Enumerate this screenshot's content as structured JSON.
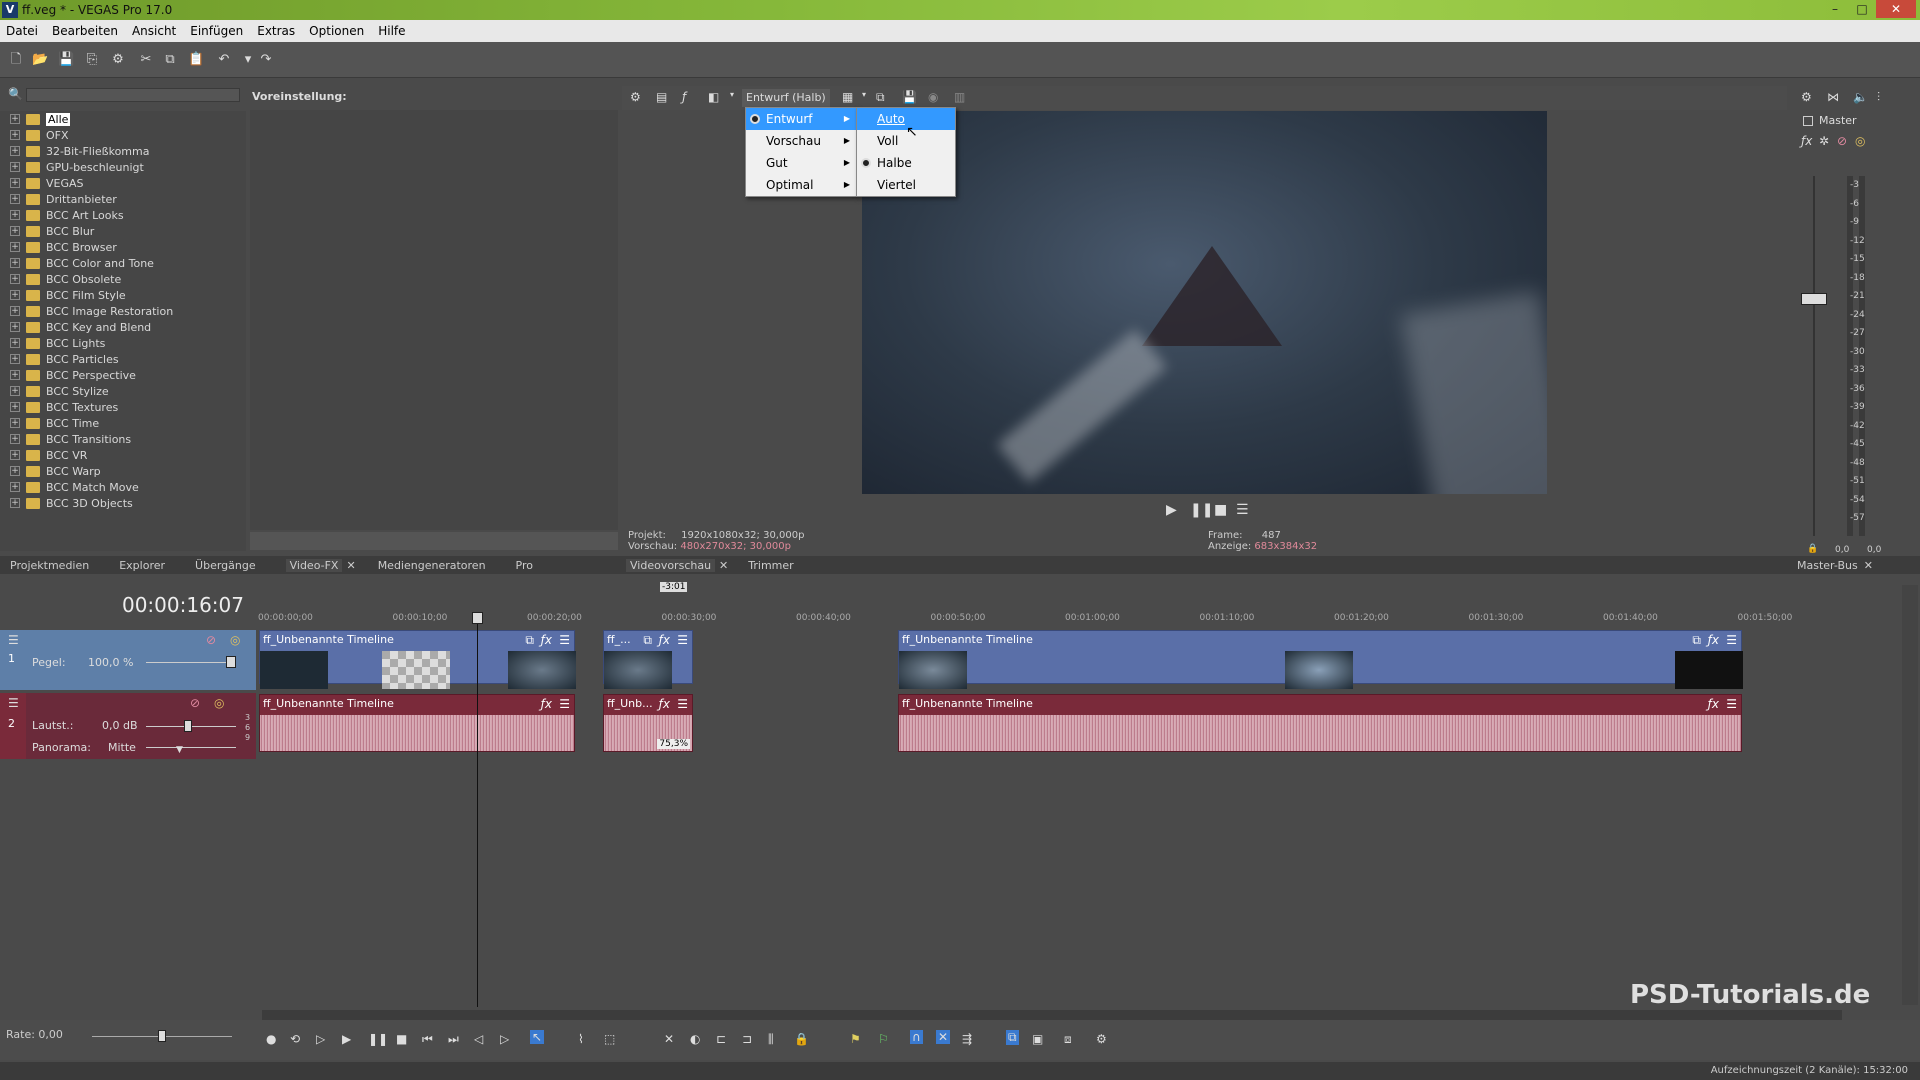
{
  "window": {
    "title": "ff.veg * - VEGAS Pro 17.0",
    "icon": "V",
    "min": "–",
    "max": "□",
    "close": "✕"
  },
  "menubar": [
    "Datei",
    "Bearbeiten",
    "Ansicht",
    "Einfügen",
    "Extras",
    "Optionen",
    "Hilfe"
  ],
  "left_panel": {
    "preset_label": "Voreinstellung:",
    "tree": [
      "Alle",
      "OFX",
      "32-Bit-Fließkomma",
      "GPU-beschleunigt",
      "VEGAS",
      "Drittanbieter",
      "BCC Art Looks",
      "BCC Blur",
      "BCC Browser",
      "BCC Color and Tone",
      "BCC Obsolete",
      "BCC Film Style",
      "BCC Image Restoration",
      "BCC Key and Blend",
      "BCC Lights",
      "BCC Particles",
      "BCC Perspective",
      "BCC Stylize",
      "BCC Textures",
      "BCC Time",
      "BCC Transitions",
      "BCC VR",
      "BCC Warp",
      "BCC Match Move",
      "BCC 3D Objects"
    ],
    "tabs": [
      "Projektmedien",
      "Explorer",
      "Übergänge",
      "Video-FX",
      "Mediengeneratoren",
      "Pro"
    ]
  },
  "preview": {
    "quality": "Entwurf (Halb)",
    "menu": [
      "Entwurf",
      "Vorschau",
      "Gut",
      "Optimal"
    ],
    "submenu": [
      "Auto",
      "Voll",
      "Halbe",
      "Viertel"
    ],
    "projekt_label": "Projekt:",
    "projekt_value": "1920x1080x32; 30,000p",
    "vorschau_label": "Vorschau:",
    "vorschau_value": "480x270x32; 30,000p",
    "frame_label": "Frame:",
    "frame_value": "487",
    "anzeige_label": "Anzeige:",
    "anzeige_value": "683x384x32",
    "tabs": [
      "Videovorschau",
      "Trimmer"
    ]
  },
  "master": {
    "label": "Master",
    "tab": "Master-Bus",
    "scale": [
      "3",
      "6",
      "9",
      "12",
      "15",
      "18",
      "21",
      "24",
      "27",
      "30",
      "33",
      "36",
      "39",
      "42",
      "45",
      "48",
      "51",
      "54",
      "57"
    ],
    "readout_left": "0,0",
    "readout_right": "0,0"
  },
  "timeline": {
    "timecode": "00:00:16:07",
    "marker": "-3:01",
    "ruler": [
      "00:00:00;00",
      "00:00:10;00",
      "00:00:20;00",
      "00:00:30;00",
      "00:00:40;00",
      "00:00:50;00",
      "00:01:00;00",
      "00:01:10;00",
      "00:01:20;00",
      "00:01:30;00",
      "00:01:40;00",
      "00:01:50;00"
    ],
    "video_track": {
      "num": "1",
      "pegel_label": "Pegel:",
      "pegel_value": "100,0 %"
    },
    "audio_track": {
      "num": "2",
      "laut_label": "Lautst.:",
      "laut_value": "0,0 dB",
      "pan_label": "Panorama:",
      "pan_value": "Mitte",
      "scale": [
        "3",
        "6",
        "9"
      ]
    },
    "clip_full": "ff_Unbenannte Timeline",
    "clip_short_v": "ff_...",
    "clip_short_a": "ff_Unb...",
    "clip_pct": "75,3%"
  },
  "bottom": {
    "rate": "Rate: 0,00",
    "record_time": "Aufzeichnungszeit (2 Kanäle): 15:32:00",
    "watermark": "PSD-Tutorials.de"
  }
}
